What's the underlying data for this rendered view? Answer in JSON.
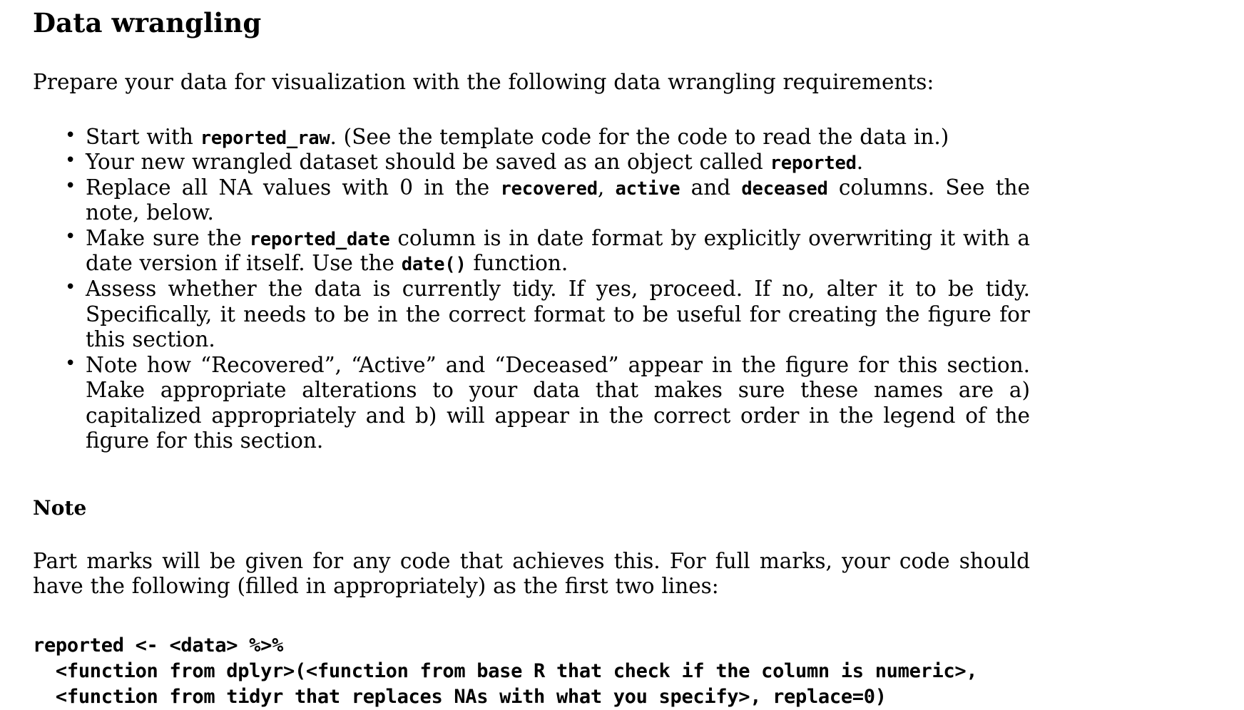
{
  "document": {
    "section_heading": "Data wrangling",
    "intro_paragraph": "Prepare your data for visualization with the following data wrangling requirements:",
    "bullets": [
      {
        "id": "start-with-reported-raw",
        "parts": [
          {
            "type": "text",
            "value": "Start with "
          },
          {
            "type": "code",
            "value": "reported_raw"
          },
          {
            "type": "text",
            "value": ". (See the template code for the code to read the data in.)"
          }
        ]
      },
      {
        "id": "save-as-reported",
        "parts": [
          {
            "type": "text",
            "value": "Your new wrangled dataset should be saved as an object called "
          },
          {
            "type": "code",
            "value": "reported"
          },
          {
            "type": "text",
            "value": "."
          }
        ]
      },
      {
        "id": "replace-na-with-zero",
        "parts": [
          {
            "type": "text",
            "value": "Replace all NA values with 0 in the "
          },
          {
            "type": "code",
            "value": "recovered"
          },
          {
            "type": "text",
            "value": ", "
          },
          {
            "type": "code",
            "value": "active"
          },
          {
            "type": "text",
            "value": " and "
          },
          {
            "type": "code",
            "value": "deceased"
          },
          {
            "type": "text",
            "value": " columns. See the note, below."
          }
        ]
      },
      {
        "id": "reported-date-format",
        "parts": [
          {
            "type": "text",
            "value": "Make sure the "
          },
          {
            "type": "code",
            "value": "reported_date"
          },
          {
            "type": "text",
            "value": " column is in date format by explicitly overwriting it with a date version if itself. Use the "
          },
          {
            "type": "code",
            "value": "date()"
          },
          {
            "type": "text",
            "value": " function."
          }
        ]
      },
      {
        "id": "assess-tidy",
        "parts": [
          {
            "type": "text",
            "value": "Assess whether the data is currently tidy. If yes, proceed. If no, alter it to be tidy. Specifically, it needs to be in the correct format to be useful for creating the figure for this section."
          }
        ]
      },
      {
        "id": "legend-naming-order",
        "parts": [
          {
            "type": "text",
            "value": "Note how “Recovered”, “Active” and “Deceased” appear in the figure for this section. Make appropriate alterations to your data that makes sure these names are a) capitalized appropriately and b) will appear in the correct order in the legend of the figure for this section."
          }
        ]
      }
    ],
    "note": {
      "heading": "Note",
      "paragraph": "Part marks will be given for any code that achieves this. For full marks, your code should have the following (filled in appropriately) as the first two lines:",
      "code_lines": [
        "reported <- <data> %>%",
        "  <function from dplyr>(<function from base R that check if the column is numeric>,",
        "  <function from tidyr that replaces NAs with what you specify>, replace=0)"
      ]
    },
    "colors": {
      "page_background": "#ffffff",
      "text": "#000000"
    }
  }
}
